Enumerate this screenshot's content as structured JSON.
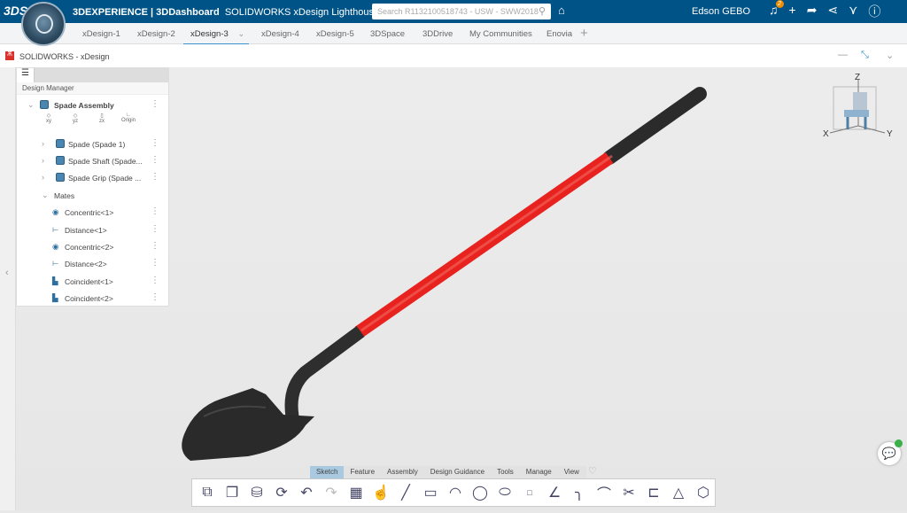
{
  "topbar": {
    "logo": "3DS",
    "title_brand": "3DEXPERIENCE | 3DDashboard",
    "title_dash": "SOLIDWORKS xDesign Lighthouse",
    "search_placeholder": "Search R1132100518743 - USW - SWW2018",
    "user": "Edson GEBO",
    "notifications": "2"
  },
  "tabs": [
    "xDesign-1",
    "xDesign-2",
    "xDesign-3",
    "xDesign-4",
    "xDesign-5",
    "3DSpace",
    "3DDrive",
    "My Communities",
    "Enovia"
  ],
  "widget": {
    "title": "SOLIDWORKS - xDesign"
  },
  "panel": {
    "title": "Design Manager",
    "root": "Spade Assembly",
    "planes": [
      "xy",
      "yz",
      "zx",
      "Origin"
    ],
    "parts": [
      "Spade (Spade 1)",
      "Spade Shaft (Spade...",
      "Spade Grip (Spade ..."
    ],
    "mates_label": "Mates",
    "mates": [
      "Concentric<1>",
      "Distance<1>",
      "Concentric<2>",
      "Distance<2>",
      "Coincident<1>",
      "Coincident<2>"
    ]
  },
  "triad": {
    "z": "Z",
    "x": "X",
    "y": "Y"
  },
  "ribbon": {
    "tabs": [
      "Sketch",
      "Feature",
      "Assembly",
      "Design Guidance",
      "Tools",
      "Manage",
      "View"
    ]
  },
  "colors": {
    "topbar": "#005386",
    "shaft": "#e8231f",
    "grip": "#2b2b2b"
  }
}
